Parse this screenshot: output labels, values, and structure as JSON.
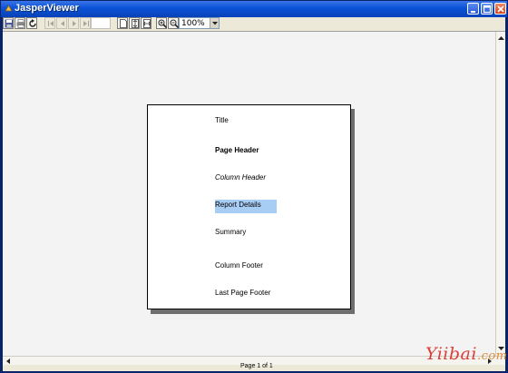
{
  "window": {
    "title": "JasperViewer"
  },
  "toolbar": {
    "zoom": "100%",
    "page_value": ""
  },
  "report": {
    "bands": [
      {
        "label": "Title",
        "style": "normal"
      },
      {
        "label": "Page Header",
        "style": "bold"
      },
      {
        "label": "Column Header",
        "style": "italic"
      },
      {
        "label": "Report Details",
        "style": "selected"
      },
      {
        "label": "Summary",
        "style": "normal"
      },
      {
        "label": "Column Footer",
        "style": "normal"
      },
      {
        "label": "Last Page Footer",
        "style": "normal"
      }
    ],
    "selection_color": "#a8cdf5"
  },
  "status": {
    "text": "Page 1 of 1"
  },
  "watermark": {
    "brand": "Yiibai",
    "suffix": ".com"
  },
  "colors": {
    "titlebar": "#0a52d6",
    "chrome": "#ece9d8",
    "viewport": "#f3f3f3",
    "watermark": "#d9403a"
  },
  "icons": [
    "save-icon",
    "print-icon",
    "reload-icon",
    "first-page-icon",
    "previous-page-icon",
    "next-page-icon",
    "last-page-icon",
    "actual-size-icon",
    "fit-page-icon",
    "fit-width-icon",
    "zoom-in-icon",
    "zoom-out-icon",
    "chevron-down-icon",
    "minimize-icon",
    "maximize-icon",
    "close-icon"
  ]
}
